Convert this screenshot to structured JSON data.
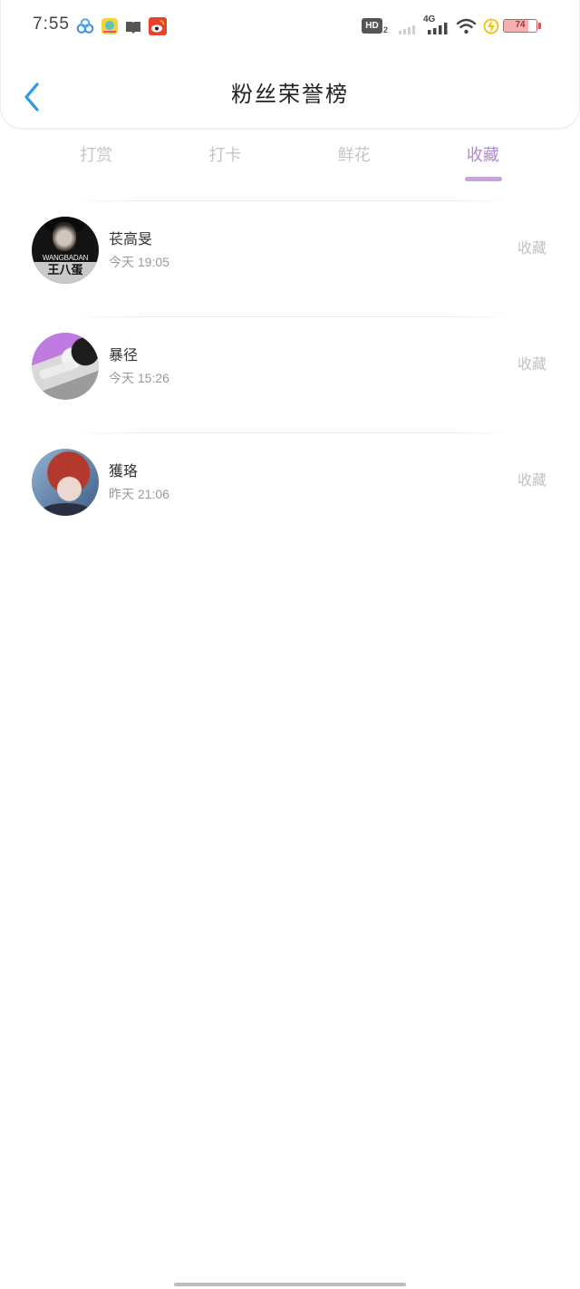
{
  "status_bar": {
    "time": "7:55",
    "app_icons": [
      "cloud-app-icon",
      "colorful-app-icon",
      "message-app-icon",
      "weibo-icon"
    ],
    "hd_label": "HD",
    "hd_sub": "2",
    "network": "4G",
    "battery_level": "74",
    "charging": true
  },
  "header": {
    "title": "粉丝荣誉榜",
    "back_icon": "back-chevron-icon"
  },
  "tabs": [
    {
      "label": "打赏",
      "active": false
    },
    {
      "label": "打卡",
      "active": false
    },
    {
      "label": "鲜花",
      "active": false
    },
    {
      "label": "收藏",
      "active": true
    }
  ],
  "list": [
    {
      "name": "苌高旻",
      "time": "今天 19:05",
      "action": "收藏",
      "avatar_caption_en": "WANGBADAN",
      "avatar_caption_zh": "王八蛋"
    },
    {
      "name": "暴径",
      "time": "今天 15:26",
      "action": "收藏"
    },
    {
      "name": "獲珞",
      "time": "昨天 21:06",
      "action": "收藏"
    }
  ],
  "colors": {
    "accent": "#b584d8",
    "back_arrow": "#2a9be6",
    "tab_inactive": "#c6c6c6",
    "text_primary": "#333333",
    "text_secondary": "#9a9a9a"
  }
}
